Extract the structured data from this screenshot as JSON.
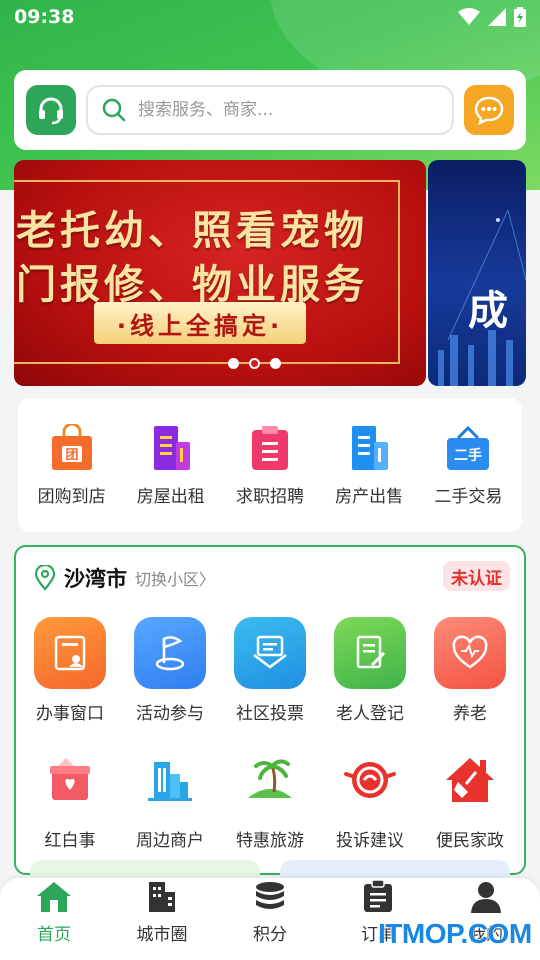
{
  "status_bar": {
    "time": "09:38",
    "icons": [
      "wifi-icon",
      "signal-icon",
      "battery-icon"
    ]
  },
  "search": {
    "placeholder": "搜索服务、商家..."
  },
  "banner": {
    "line1": "老托幼、照看宠物",
    "line2": "门报修、物业服务",
    "pill": "·线上全搞定·",
    "next_slide_text": "成",
    "pager": {
      "count": 3,
      "active_index": 1
    }
  },
  "quick_links": [
    {
      "label": "团购到店",
      "icon": "group-buy-bag-icon"
    },
    {
      "label": "房屋出租",
      "icon": "building-rent-icon"
    },
    {
      "label": "求职招聘",
      "icon": "clipboard-job-icon"
    },
    {
      "label": "房产出售",
      "icon": "building-sale-icon"
    },
    {
      "label": "二手交易",
      "icon": "second-hand-tag-icon"
    }
  ],
  "community": {
    "city": "沙湾市",
    "switch_label": "切换小区",
    "badge": "未认证",
    "services": [
      {
        "label": "办事窗口",
        "icon": "id-card-icon"
      },
      {
        "label": "活动参与",
        "icon": "flag-icon"
      },
      {
        "label": "社区投票",
        "icon": "vote-box-icon"
      },
      {
        "label": "老人登记",
        "icon": "register-form-icon"
      },
      {
        "label": "养老",
        "icon": "heart-care-icon"
      },
      {
        "label": "红白事",
        "icon": "gift-box-icon"
      },
      {
        "label": "周边商户",
        "icon": "city-buildings-icon"
      },
      {
        "label": "特惠旅游",
        "icon": "palm-beach-icon"
      },
      {
        "label": "投诉建议",
        "icon": "whistle-icon"
      },
      {
        "label": "便民家政",
        "icon": "house-broom-icon"
      }
    ]
  },
  "tabs": [
    {
      "label": "首页",
      "icon": "home-icon",
      "active": true
    },
    {
      "label": "城市圈",
      "icon": "city-icon",
      "active": false
    },
    {
      "label": "积分",
      "icon": "coins-icon",
      "active": false
    },
    {
      "label": "订单",
      "icon": "order-clipboard-icon",
      "active": false
    },
    {
      "label": "我的",
      "icon": "user-icon",
      "active": false
    }
  ],
  "watermark": "ITMOP.COM",
  "colors": {
    "brand_green": "#2ea65a",
    "accent_orange": "#f5a623",
    "badge_red": "#e0312d"
  }
}
